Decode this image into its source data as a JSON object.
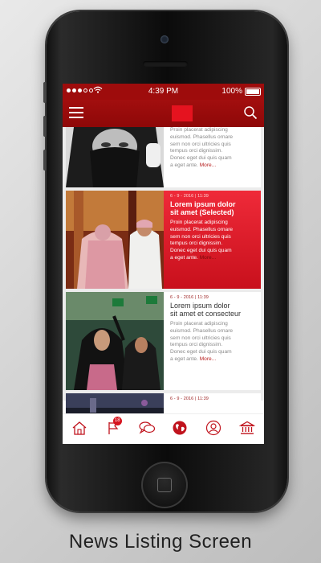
{
  "status_bar": {
    "time": "4:39 PM",
    "battery": "100%"
  },
  "tabs": [
    {
      "name": "home-icon"
    },
    {
      "name": "flag-icon",
      "badge": "18"
    },
    {
      "name": "chat-bubbles-icon"
    },
    {
      "name": "globe-icon"
    },
    {
      "name": "profile-icon"
    },
    {
      "name": "institution-icon"
    }
  ],
  "articles": [
    {
      "excerpt_lines": [
        "Proin placerat adipiscing",
        "euismod. Phasellus ornare",
        "sem non orci ultricies quis",
        "tempus orci dignissim.",
        "Donec eget dui quis quam",
        "a eget ante."
      ],
      "more": "More..."
    },
    {
      "date": "6 - 9 - 2016 | 11:39",
      "title_lines": [
        "Lorem ipsum dolor",
        "sit amet (Selected)"
      ],
      "excerpt_lines": [
        "Proin placerat adipiscing",
        "euismod. Phasellus ornare",
        "sem non orci ultricies quis",
        "tempus orci dignissim.",
        "Donec eget dui quis quam",
        "a eget ante."
      ],
      "more": "More..."
    },
    {
      "date": "6 - 9 - 2016 | 11:39",
      "title_lines": [
        "Lorem ipsum dolor",
        "sit amet et consecteur"
      ],
      "excerpt_lines": [
        "Proin placerat adipiscing",
        "euismod. Phasellus ornare",
        "sem non orci ultricies quis",
        "tempus orci dignissim.",
        "Donec eget dui quis quam",
        "a eget ante."
      ],
      "more": "More..."
    },
    {
      "date": "6 - 9 - 2016 | 11:39"
    }
  ],
  "caption": "News Listing Screen",
  "colors": {
    "primary": "#9e0c0c",
    "accent": "#e5131f",
    "selected": "#d6141f"
  }
}
